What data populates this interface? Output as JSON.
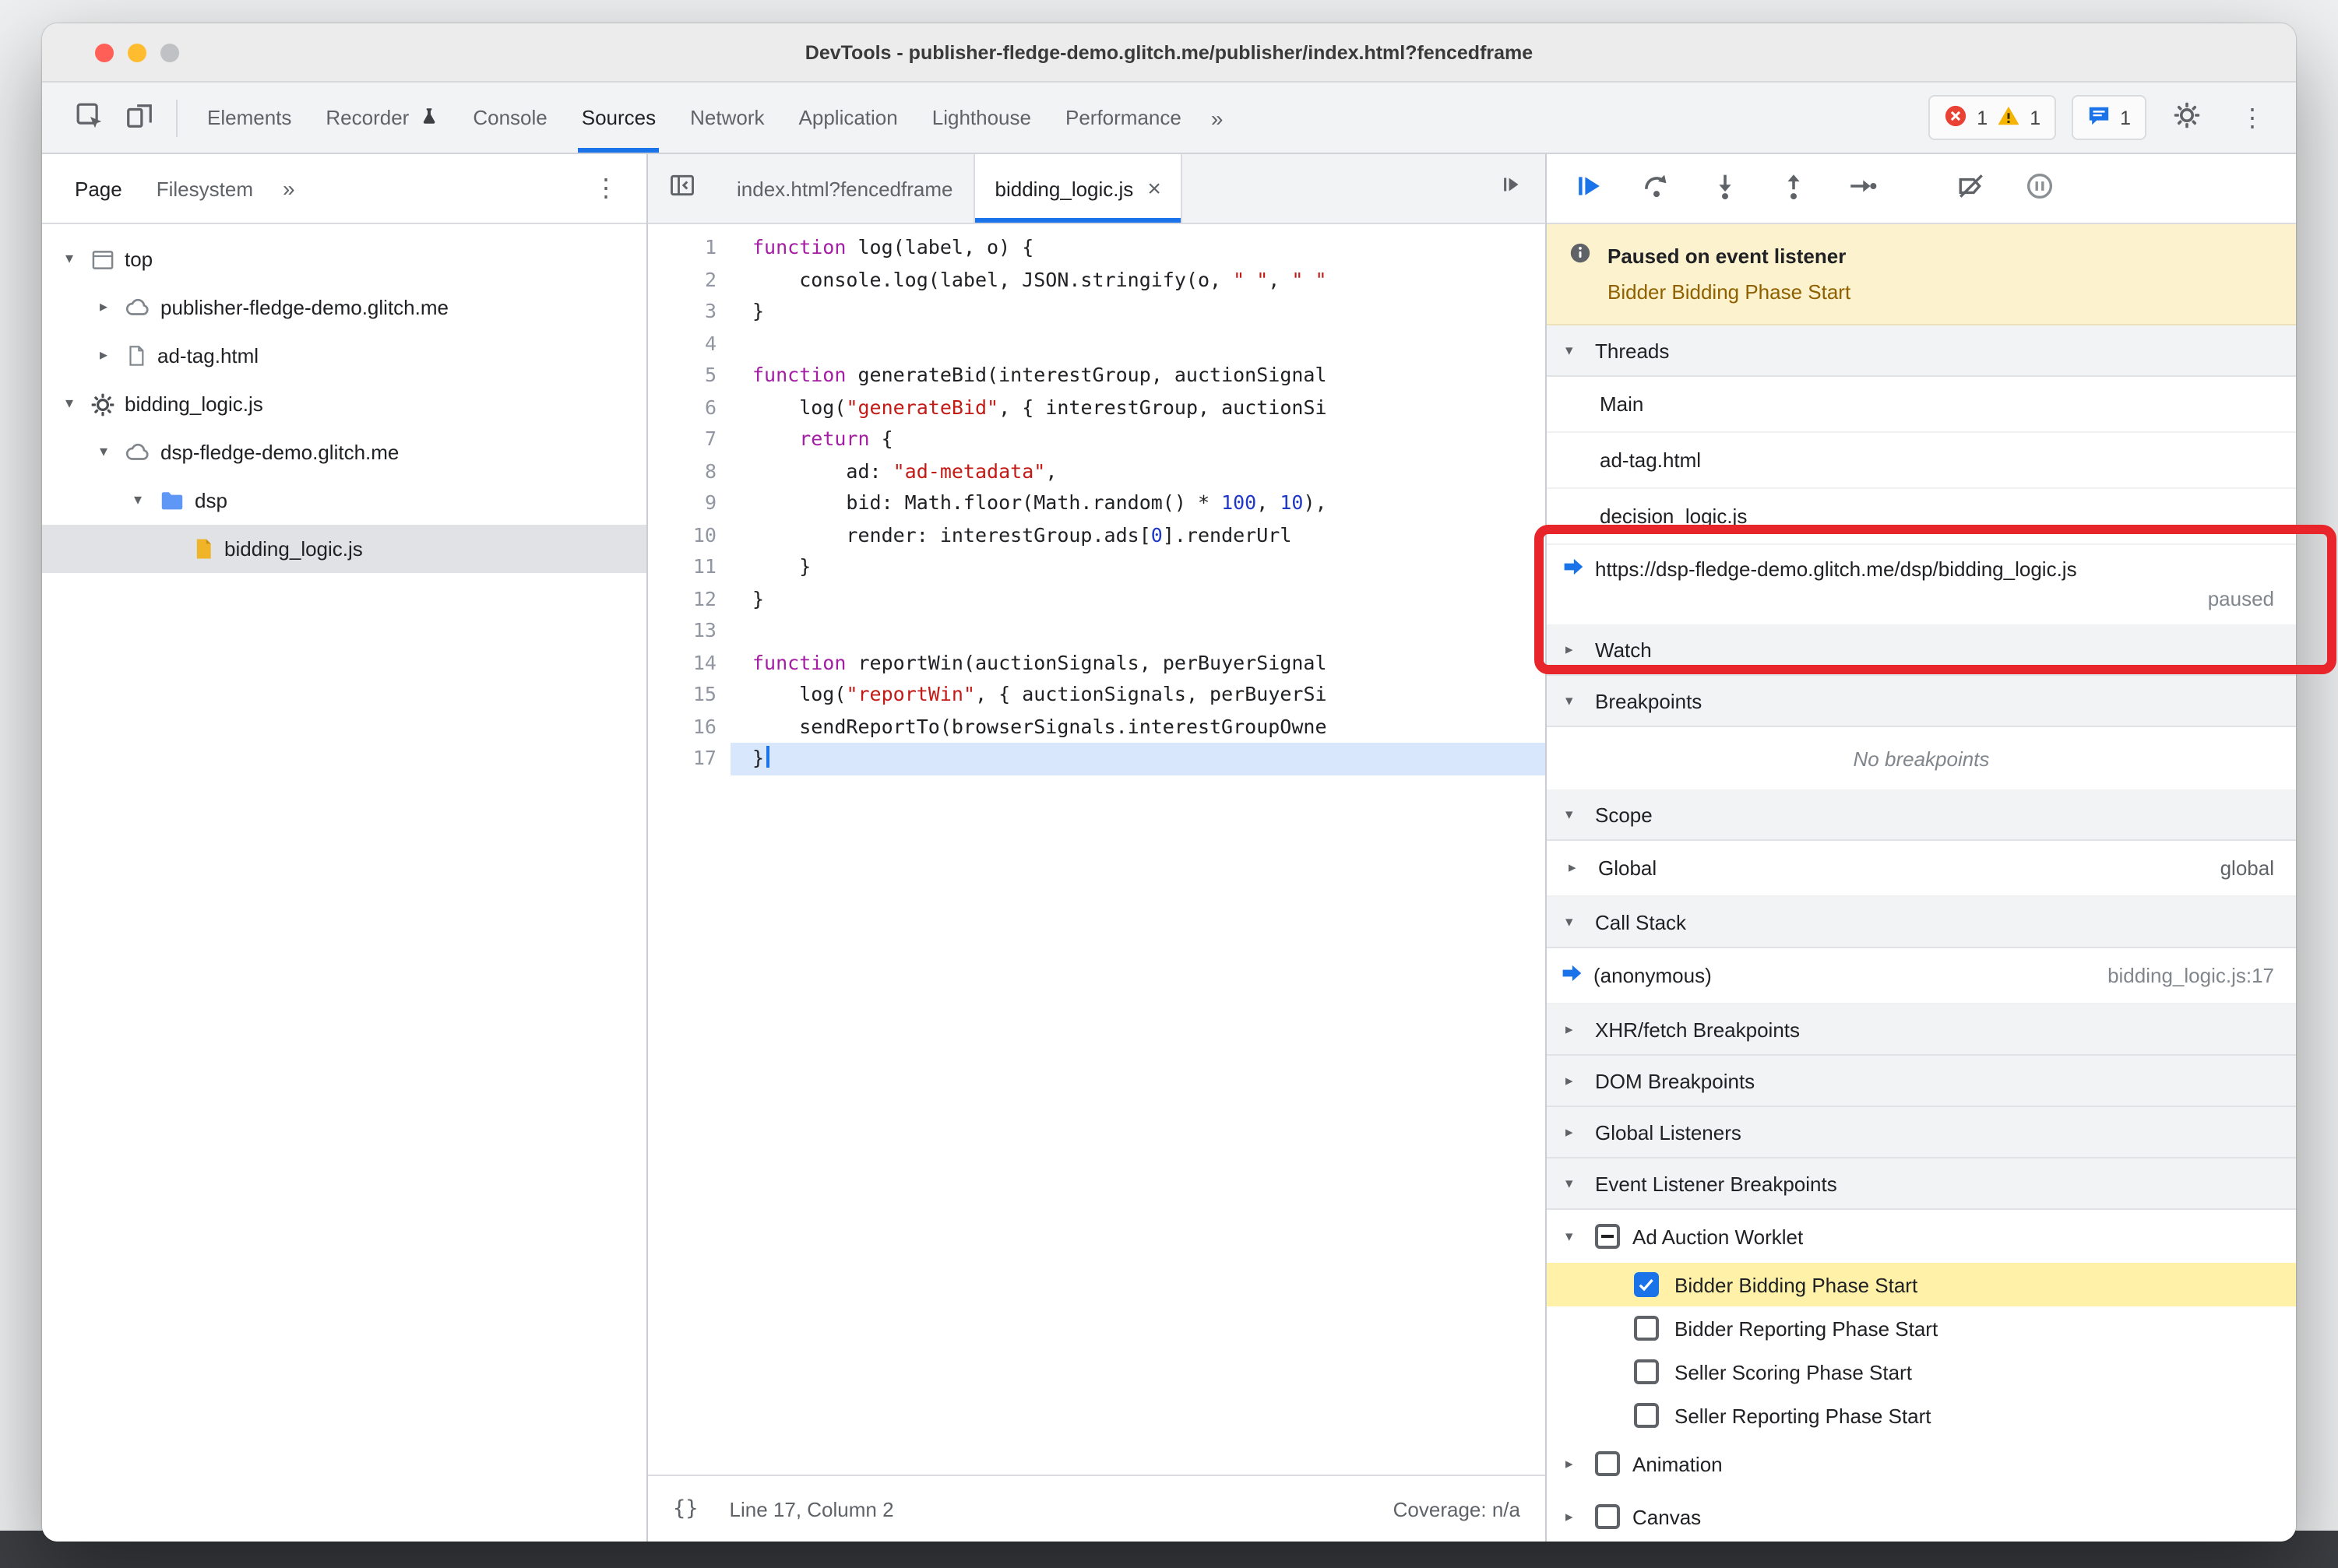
{
  "window": {
    "title": "DevTools - publisher-fledge-demo.glitch.me/publisher/index.html?fencedframe"
  },
  "toolbar": {
    "tabs": [
      "Elements",
      "Recorder",
      "Console",
      "Sources",
      "Network",
      "Application",
      "Lighthouse",
      "Performance"
    ],
    "more": "»",
    "error_count": "1",
    "warning_count": "1",
    "issues_count": "1"
  },
  "sidebar": {
    "tab_page": "Page",
    "tab_filesystem": "Filesystem",
    "more": "»",
    "tree": [
      {
        "label": "top"
      },
      {
        "label": "publisher-fledge-demo.glitch.me"
      },
      {
        "label": "ad-tag.html"
      },
      {
        "label": "bidding_logic.js"
      },
      {
        "label": "dsp-fledge-demo.glitch.me"
      },
      {
        "label": "dsp"
      },
      {
        "label": "bidding_logic.js"
      }
    ]
  },
  "editor": {
    "tab1": "index.html?fencedframe",
    "tab2": "bidding_logic.js",
    "close": "×",
    "lines": [
      {
        "n": "1",
        "s": [
          "function",
          " log(label, o) {"
        ]
      },
      {
        "n": "2",
        "s": [
          "    console.log(label, JSON.stringify(o, ",
          "\" \"",
          ", ",
          "\" \""
        ]
      },
      {
        "n": "3",
        "s": [
          "}"
        ]
      },
      {
        "n": "4",
        "s": []
      },
      {
        "n": "5",
        "s": [
          "function",
          " generateBid(interestGroup, auctionSignal"
        ]
      },
      {
        "n": "6",
        "s": [
          "    log(",
          "\"generateBid\"",
          ", { interestGroup, auctionSi"
        ]
      },
      {
        "n": "7",
        "s": [
          "    ",
          "return",
          " {"
        ]
      },
      {
        "n": "8",
        "s": [
          "        ad: ",
          "\"ad-metadata\"",
          ","
        ]
      },
      {
        "n": "9",
        "s": [
          "        bid: Math.floor(Math.random() * ",
          "100",
          ", ",
          "10",
          "),"
        ]
      },
      {
        "n": "10",
        "s": [
          "        render: interestGroup.ads[",
          "0",
          "].renderUrl"
        ]
      },
      {
        "n": "11",
        "s": [
          "    }"
        ]
      },
      {
        "n": "12",
        "s": [
          "}"
        ]
      },
      {
        "n": "13",
        "s": []
      },
      {
        "n": "14",
        "s": [
          "function",
          " reportWin(auctionSignals, perBuyerSignal"
        ]
      },
      {
        "n": "15",
        "s": [
          "    log(",
          "\"reportWin\"",
          ", { auctionSignals, perBuyerSi"
        ]
      },
      {
        "n": "16",
        "s": [
          "    sendReportTo(browserSignals.interestGroupOwne"
        ]
      },
      {
        "n": "17",
        "s": [
          "}"
        ]
      }
    ],
    "status": {
      "brackets": "{}",
      "line_col": "Line 17, Column 2",
      "coverage": "Coverage: n/a"
    }
  },
  "debugger": {
    "paused_title": "Paused on event listener",
    "paused_subtitle": "Bidder Bidding Phase Start",
    "threads": {
      "title": "Threads",
      "rows": [
        "Main",
        "ad-tag.html",
        "decision_logic.js"
      ],
      "active_url": "https://dsp-fledge-demo.glitch.me/dsp/bidding_logic.js",
      "active_status": "paused"
    },
    "watch_title": "Watch",
    "breakpoints_title": "Breakpoints",
    "breakpoints_empty": "No breakpoints",
    "scope_title": "Scope",
    "scope_row": {
      "label": "Global",
      "value": "global"
    },
    "callstack_title": "Call Stack",
    "callstack_row": {
      "label": "(anonymous)",
      "location": "bidding_logic.js:17"
    },
    "xhr_title": "XHR/fetch Breakpoints",
    "dom_title": "DOM Breakpoints",
    "global_listeners_title": "Global Listeners",
    "elb_title": "Event Listener Breakpoints",
    "elb": {
      "group1": "Ad Auction Worklet",
      "items": [
        "Bidder Bidding Phase Start",
        "Bidder Reporting Phase Start",
        "Seller Scoring Phase Start",
        "Seller Reporting Phase Start"
      ],
      "group2": "Animation",
      "group3": "Canvas"
    }
  },
  "colors": {
    "accent_blue": "#1a73e8",
    "annotation_red": "#e8252a",
    "paused_banner_bg": "#fcf2cd",
    "breakpoint_hit_bg": "#fff2a8",
    "exec_line_bg": "#d9e7fd",
    "syntax_keyword": "#a41ea4",
    "syntax_string": "#c41a16",
    "syntax_number": "#1e39c8",
    "error_red": "#e94235",
    "warning_yellow": "#f5b401"
  }
}
